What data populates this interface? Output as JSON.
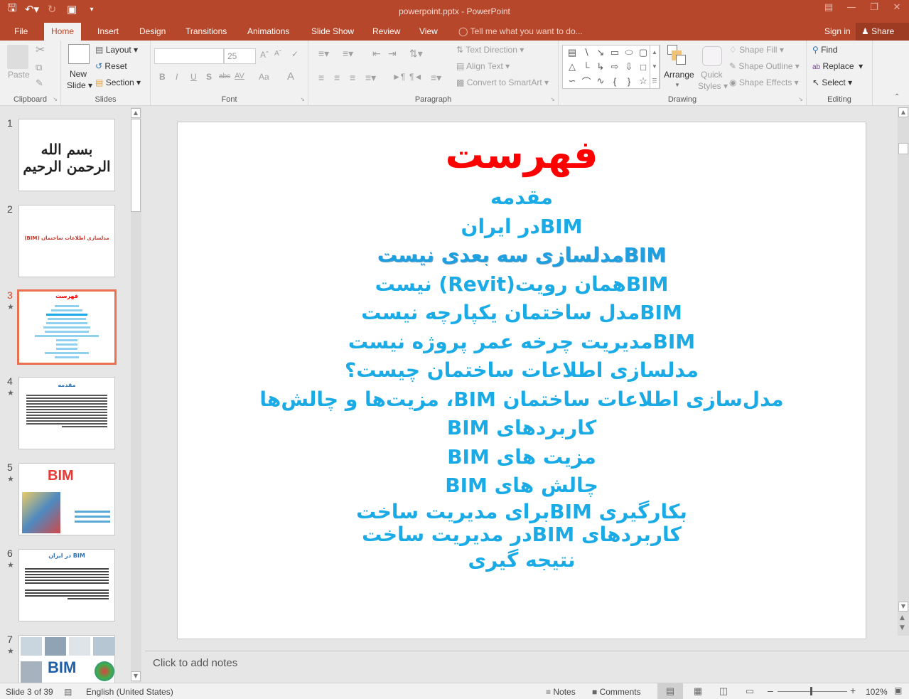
{
  "window": {
    "title": "powerpoint.pptx - PowerPoint",
    "controls": [
      "ribbon-display-options",
      "minimize",
      "restore",
      "close"
    ]
  },
  "quick_access": {
    "save_icon": "save-icon",
    "undo_icon": "undo-icon",
    "redo_icon": "redo-icon",
    "present_icon": "start-from-beginning-icon",
    "customize_icon": "customize-qat-icon"
  },
  "tabs": [
    {
      "label": "File"
    },
    {
      "label": "Home",
      "active": true
    },
    {
      "label": "Insert"
    },
    {
      "label": "Design"
    },
    {
      "label": "Transitions"
    },
    {
      "label": "Animations"
    },
    {
      "label": "Slide Show"
    },
    {
      "label": "Review"
    },
    {
      "label": "View"
    }
  ],
  "tell_me": "Tell me what you want to do...",
  "sign_in": "Sign in",
  "share": "Share",
  "ribbon": {
    "clipboard": {
      "label": "Clipboard",
      "paste": "Paste"
    },
    "slides": {
      "label": "Slides",
      "new_slide_line1": "New",
      "new_slide_line2": "Slide",
      "layout": "Layout",
      "reset": "Reset",
      "section": "Section"
    },
    "font": {
      "label": "Font",
      "font_name": "",
      "font_size": "25",
      "bold": "B",
      "italic": "I",
      "underline": "U",
      "shadow": "S",
      "strike": "abc",
      "spacing": "AV",
      "case": "Aa",
      "color": "A"
    },
    "paragraph": {
      "label": "Paragraph",
      "text_direction": "Text Direction",
      "align_text": "Align Text",
      "convert_smartart": "Convert to SmartArt"
    },
    "drawing": {
      "label": "Drawing",
      "arrange": "Arrange",
      "quick_styles_line1": "Quick",
      "quick_styles_line2": "Styles",
      "shape_fill": "Shape Fill",
      "shape_outline": "Shape Outline",
      "shape_effects": "Shape Effects"
    },
    "editing": {
      "label": "Editing",
      "find": "Find",
      "replace": "Replace",
      "select": "Select"
    }
  },
  "thumbnails": [
    {
      "number": "1",
      "starred": false,
      "content": "بسم الله الرحمن الرحیم"
    },
    {
      "number": "2",
      "starred": false,
      "content": "مدلسازی اطلاعات ساختمان (BIM)"
    },
    {
      "number": "3",
      "starred": true,
      "active": true,
      "content": "فهرست"
    },
    {
      "number": "4",
      "starred": true,
      "content": "مقدمه"
    },
    {
      "number": "5",
      "starred": true,
      "content": "BIM"
    },
    {
      "number": "6",
      "starred": true,
      "content": "BIM در ایران"
    },
    {
      "number": "7",
      "starred": true,
      "content": "BIM"
    }
  ],
  "slide": {
    "title": "فهرست",
    "title_color": "#ff0000",
    "item_color": "#1aabe6",
    "items": [
      "مقدمه",
      "BIMدر ایران",
      "BIMمدلسازی سه بعدی نیست",
      "BIMهمان رویت(Revit) نیست",
      "BIMمدل ساختمان یکپارچه نیست",
      "BIMمدیریت چرخه عمر پروژه نیست",
      "مدلسازی اطلاعات ساختمان چیست؟",
      "مدل‌سازی اطلاعات ساختمان BIM، مزیت‌ها و چالش‌ها",
      "کاربردهای BIM",
      "مزیت های BIM",
      "چالش های BIM",
      "بکارگیری  BIMبرای مدیریت ساخت",
      "کاربردهای  BIMدر مدیریت ساخت",
      "نتیجه گیری"
    ]
  },
  "notes_placeholder": "Click to add notes",
  "status": {
    "slide_info": "Slide 3 of 39",
    "language": "English (United States)",
    "notes": "Notes",
    "comments": "Comments",
    "zoom": "102%"
  }
}
